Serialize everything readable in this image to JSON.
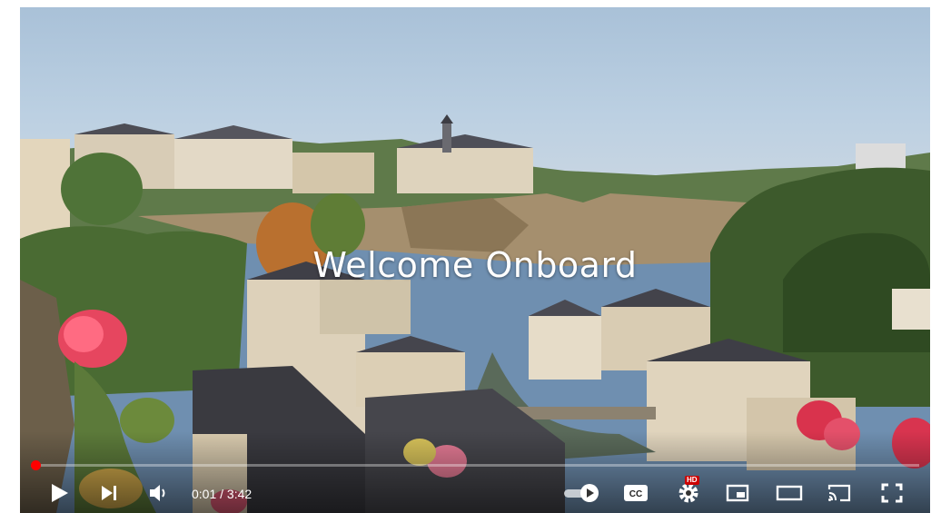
{
  "video": {
    "title_overlay": "Welcome Onboard",
    "progress_fraction": 0.005
  },
  "controls": {
    "time_current": "0:01",
    "time_separator": " / ",
    "time_total": "3:42",
    "icons": [
      "play-icon",
      "next-icon",
      "volume-icon",
      "autoplay-toggle-icon",
      "captions-icon",
      "settings-icon",
      "miniplayer-icon",
      "theater-icon",
      "cast-icon",
      "fullscreen-icon"
    ],
    "settings_badge": "HD",
    "captions_label": "CC"
  },
  "colors": {
    "progress": "#ff0000",
    "hd_badge": "#cc0000",
    "control_icons": "#ffffff"
  }
}
